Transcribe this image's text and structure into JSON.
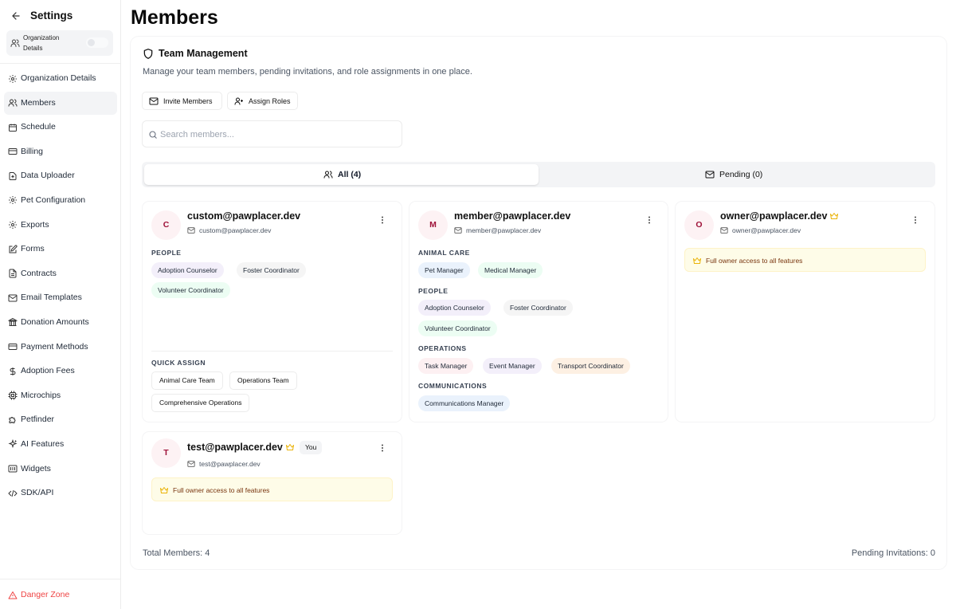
{
  "sidebar": {
    "title": "Settings",
    "org_switch": {
      "label_line1": "Organization",
      "label_line2": "Details"
    },
    "items": [
      {
        "label": "Organization Details",
        "icon": "gear-icon"
      },
      {
        "label": "Members",
        "icon": "users-icon",
        "active": true
      },
      {
        "label": "Schedule",
        "icon": "calendar-icon"
      },
      {
        "label": "Billing",
        "icon": "credit-card-icon"
      },
      {
        "label": "Data Uploader",
        "icon": "upload-icon"
      },
      {
        "label": "Pet Configuration",
        "icon": "gear-icon"
      },
      {
        "label": "Exports",
        "icon": "gear-icon"
      },
      {
        "label": "Forms",
        "icon": "edit-icon"
      },
      {
        "label": "Contracts",
        "icon": "document-icon"
      },
      {
        "label": "Email Templates",
        "icon": "mail-icon"
      },
      {
        "label": "Donation Amounts",
        "icon": "bank-icon"
      },
      {
        "label": "Payment Methods",
        "icon": "credit-card-icon"
      },
      {
        "label": "Adoption Fees",
        "icon": "dollar-icon"
      },
      {
        "label": "Microchips",
        "icon": "chip-icon"
      },
      {
        "label": "Petfinder",
        "icon": "puzzle-icon"
      },
      {
        "label": "AI Features",
        "icon": "sparkle-icon"
      },
      {
        "label": "Widgets",
        "icon": "widget-icon"
      },
      {
        "label": "SDK/API",
        "icon": "code-icon"
      }
    ],
    "danger_zone": "Danger Zone"
  },
  "page": {
    "title": "Members"
  },
  "team": {
    "title": "Team Management",
    "subtitle": "Manage your team members, pending invitations, and role assignments in one place.",
    "invite_label": "Invite Members",
    "assign_label": "Assign Roles",
    "search_placeholder": "Search members...",
    "tab_all": "All (4)",
    "tab_pending": "Pending (0)"
  },
  "members": {
    "custom": {
      "initial": "C",
      "name": "custom@pawplacer.dev",
      "email": "custom@pawplacer.dev",
      "people_label": "PEOPLE",
      "roles": [
        "Adoption Counselor",
        "Foster Coordinator",
        "Volunteer Coordinator"
      ],
      "quick_assign_label": "QUICK ASSIGN",
      "quick_assign": [
        "Animal Care Team",
        "Operations Team",
        "Comprehensive Operations"
      ]
    },
    "member": {
      "initial": "M",
      "name": "member@pawplacer.dev",
      "email": "member@pawplacer.dev",
      "animal_care_label": "ANIMAL CARE",
      "animal_care": [
        "Pet Manager",
        "Medical Manager"
      ],
      "people_label": "PEOPLE",
      "people": [
        "Adoption Counselor",
        "Foster Coordinator",
        "Volunteer Coordinator"
      ],
      "operations_label": "OPERATIONS",
      "operations": [
        "Task Manager",
        "Event Manager",
        "Transport Coordinator"
      ],
      "communications_label": "COMMUNICATIONS",
      "communications": [
        "Communications Manager"
      ]
    },
    "owner": {
      "initial": "O",
      "name": "owner@pawplacer.dev",
      "email": "owner@pawplacer.dev",
      "access": "Full owner access to all features"
    },
    "test": {
      "initial": "T",
      "name": "test@pawplacer.dev",
      "email": "test@pawplacer.dev",
      "badge": "You",
      "access": "Full owner access to all features"
    }
  },
  "footer": {
    "total": "Total Members: 4",
    "pending": "Pending Invitations: 0"
  },
  "colors": {
    "danger": "#ef4444",
    "crown": "#eab308",
    "avatar_bg": "#fdf2f4",
    "avatar_text": "#9f1239"
  }
}
